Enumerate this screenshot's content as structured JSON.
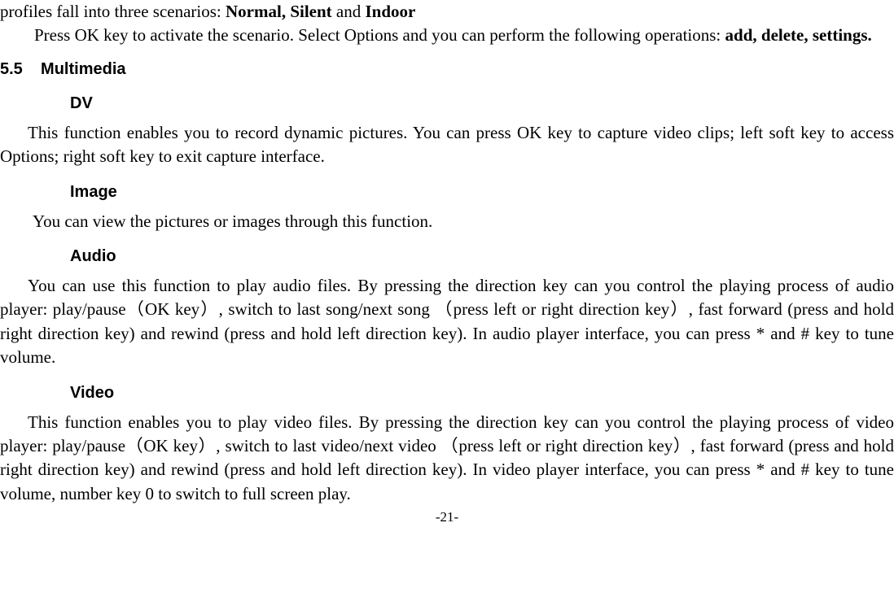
{
  "p1_a": "profiles fall into three scenarios: ",
  "p1_b": "Normal, Silent ",
  "p1_c": "and ",
  "p1_d": "Indoor",
  "p2_a": "Press OK key to activate the scenario. Select Options and you can perform the following operations: ",
  "p2_b": "add, delete, settings.",
  "h_55": "5.5",
  "h_55_title": "Multimedia",
  "h_dv": "DV",
  "p_dv": "This function enables you to record dynamic pictures. You can press OK key to capture video clips; left soft key to access Options; right soft key to exit capture interface.",
  "h_image": "Image",
  "p_image": "You can view the pictures or images through this function.",
  "h_audio": "Audio",
  "p_audio": "You can use this function to play audio files. By pressing the direction key can you control the playing process of audio player: play/pause（OK key）, switch to last song/next song （press left or right direction key）, fast forward (press and hold right direction key) and rewind (press and hold left direction key). In audio player interface, you can press * and # key to tune volume.",
  "h_video": "Video",
  "p_video": "This function enables you to play video files. By pressing the direction key can you control the playing process of video player: play/pause（OK key）, switch to last video/next video （press left or right direction key）, fast forward (press and hold right direction key) and rewind (press and hold left direction key). In video player interface, you can press * and # key to tune volume, number key 0 to switch to full screen play.",
  "page_num": "-21-"
}
